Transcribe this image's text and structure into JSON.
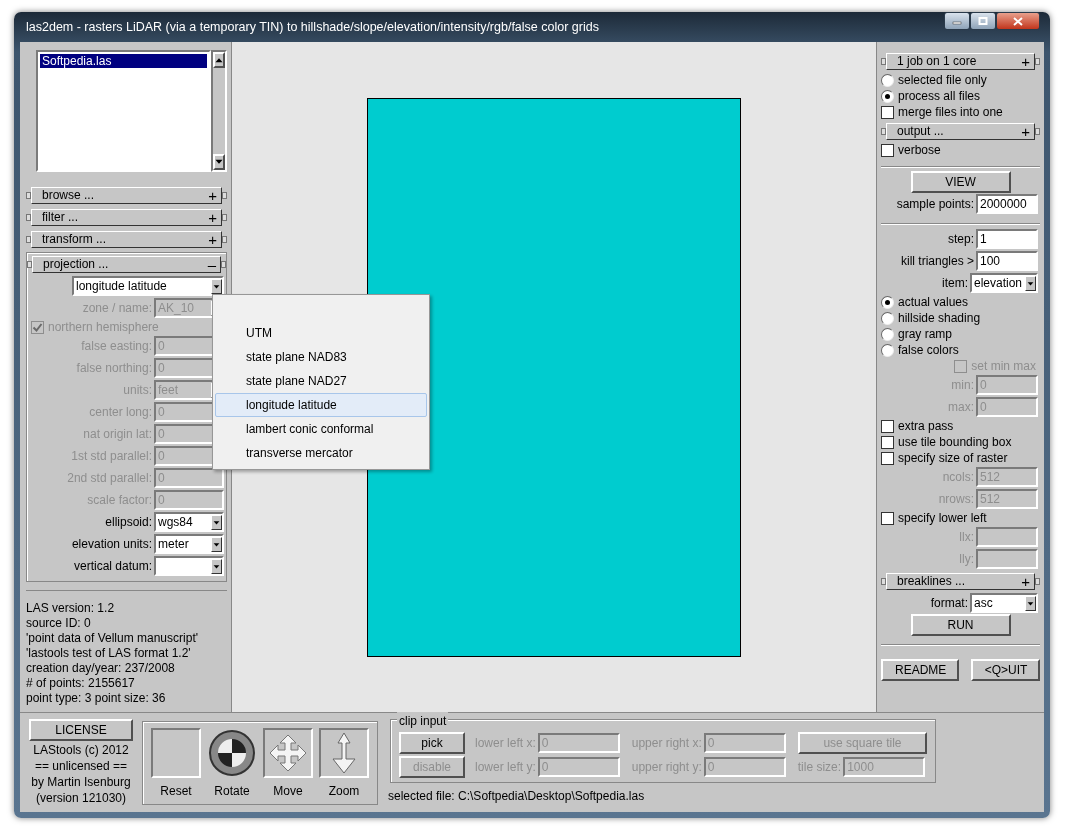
{
  "window": {
    "title": "las2dem - rasters LiDAR (via a temporary TIN) to hillshade/slope/elevation/intensity/rgb/false color grids"
  },
  "file_list": [
    {
      "label": "Softpedia.las",
      "selected": true
    }
  ],
  "sections": [
    {
      "label": "browse ...",
      "sign": "+"
    },
    {
      "label": "filter ...",
      "sign": "+"
    },
    {
      "label": "transform ...",
      "sign": "+"
    }
  ],
  "projection": {
    "label": "projection ...",
    "sign": "–",
    "rows": [
      {
        "kind": "dropdown",
        "value": "longitude latitude",
        "disabled": false
      },
      {
        "kind": "dropdown",
        "label": "zone / name:",
        "value": "AK_10",
        "disabled": true
      },
      {
        "kind": "checkbox",
        "label": "northern hemisphere",
        "checked": true,
        "disabled": true
      },
      {
        "kind": "input",
        "label": "false easting:",
        "value": "0",
        "disabled": true
      },
      {
        "kind": "input",
        "label": "false northing:",
        "value": "0",
        "disabled": true
      },
      {
        "kind": "dropdown",
        "label": "units:",
        "value": "feet",
        "disabled": true
      },
      {
        "kind": "input",
        "label": "center long:",
        "value": "0",
        "disabled": true
      },
      {
        "kind": "input",
        "label": "nat origin lat:",
        "value": "0",
        "disabled": true
      },
      {
        "kind": "input",
        "label": "1st std parallel:",
        "value": "0",
        "disabled": true
      },
      {
        "kind": "input",
        "label": "2nd std parallel:",
        "value": "0",
        "disabled": true
      },
      {
        "kind": "input",
        "label": "scale factor:",
        "value": "0",
        "disabled": true
      },
      {
        "kind": "dropdown",
        "label": "ellipsoid:",
        "value": "wgs84",
        "disabled": false
      },
      {
        "kind": "dropdown",
        "label": "elevation units:",
        "value": "meter",
        "disabled": false
      },
      {
        "kind": "dropdown",
        "label": "vertical datum:",
        "disabled": false
      }
    ]
  },
  "info": [
    "LAS version: 1.2",
    "source ID: 0",
    "'point data of Vellum manuscript'",
    "'lastools test of LAS format 1.2'",
    "creation day/year: 237/2008",
    "# of points: 2155617",
    "point type: 3 point size: 36"
  ],
  "dropdown_menu": [
    {
      "label": "UTM",
      "selected": false
    },
    {
      "label": "state plane NAD83",
      "selected": false
    },
    {
      "label": "state plane NAD27",
      "selected": false
    },
    {
      "label": "longitude latitude",
      "selected": true
    },
    {
      "label": "lambert conic conformal",
      "selected": false
    },
    {
      "label": "transverse mercator",
      "selected": false
    }
  ],
  "right_panel": [
    [
      {
        "kind": "section",
        "label": "1 job on 1 core",
        "sign": "+"
      },
      {
        "kind": "radio",
        "label": "selected file only",
        "selected": false
      },
      {
        "kind": "radio",
        "label": "process all files",
        "selected": true
      },
      {
        "kind": "checkbox",
        "label": "merge files into one",
        "checked": false
      },
      {
        "kind": "section",
        "label": "output ...",
        "sign": "+"
      },
      {
        "kind": "checkbox",
        "label": "verbose",
        "checked": false
      }
    ],
    [
      {
        "kind": "button",
        "label": "VIEW"
      },
      {
        "kind": "input",
        "label": "sample points:",
        "value": "2000000",
        "disabled": false
      }
    ],
    [
      {
        "kind": "input",
        "label": "step:",
        "value": "1",
        "disabled": false
      },
      {
        "kind": "input",
        "label": "kill triangles >",
        "value": "100",
        "disabled": false
      },
      {
        "kind": "dropdown",
        "label": "item:",
        "value": "elevation",
        "disabled": false
      },
      {
        "kind": "radio",
        "label": "actual values",
        "selected": true
      },
      {
        "kind": "radio",
        "label": "hillside shading",
        "selected": false
      },
      {
        "kind": "radio",
        "label": "gray ramp",
        "selected": false
      },
      {
        "kind": "radio",
        "label": "false colors",
        "selected": false
      },
      {
        "kind": "checkbox",
        "label": "set min max",
        "checked": false,
        "disabled": true
      },
      {
        "kind": "input",
        "label": "min:",
        "value": "0",
        "disabled": true
      },
      {
        "kind": "input",
        "label": "max:",
        "value": "0",
        "disabled": true
      },
      {
        "kind": "checkbox",
        "label": "extra pass",
        "checked": false
      },
      {
        "kind": "checkbox",
        "label": "use tile bounding box",
        "checked": false
      },
      {
        "kind": "checkbox",
        "label": "specify size of raster",
        "checked": false
      },
      {
        "kind": "input",
        "label": "ncols:",
        "value": "512",
        "disabled": true
      },
      {
        "kind": "input",
        "label": "nrows:",
        "value": "512",
        "disabled": true
      },
      {
        "kind": "checkbox",
        "label": "specify lower left",
        "checked": false
      },
      {
        "kind": "input",
        "label": "llx:",
        "disabled": true
      },
      {
        "kind": "input",
        "label": "lly:",
        "disabled": true
      },
      {
        "kind": "section",
        "label": "breaklines ...",
        "sign": "+"
      },
      {
        "kind": "dropdown",
        "label": "format:",
        "value": "asc",
        "disabled": false
      },
      {
        "kind": "button",
        "label": "RUN"
      }
    ]
  ],
  "footer_buttons": [
    {
      "label": "README"
    },
    {
      "label": "<Q>UIT"
    }
  ],
  "license": {
    "button": "LICENSE",
    "lines": [
      "LAStools (c) 2012",
      "== unlicensed ==",
      "by Martin Isenburg",
      "(version 121030)"
    ]
  },
  "tools": [
    {
      "kind": "reset",
      "label": "Reset"
    },
    {
      "kind": "rotate",
      "label": "Rotate"
    },
    {
      "kind": "move",
      "label": "Move"
    },
    {
      "kind": "zoom",
      "label": "Zoom"
    }
  ],
  "clip": {
    "title": "clip input",
    "rows": [
      [
        {
          "kind": "button",
          "label": "pick",
          "disabled": false
        },
        {
          "kind": "input",
          "label": "lower left x:",
          "value": "0",
          "disabled": true
        },
        {
          "kind": "input",
          "label": "upper right x:",
          "value": "0",
          "disabled": true
        },
        {
          "kind": "button",
          "label": "use square tile",
          "disabled": true
        }
      ],
      [
        {
          "kind": "button",
          "label": "disable",
          "disabled": true
        },
        {
          "kind": "input",
          "label": "lower left y:",
          "value": "0",
          "disabled": true
        },
        {
          "kind": "input",
          "label": "upper right y:",
          "value": "0",
          "disabled": true
        },
        {
          "kind": "input",
          "label": "tile size:",
          "value": "1000",
          "disabled": true
        }
      ]
    ],
    "selected_file": "selected file: C:\\Softpedia\\Desktop\\Softpedia.las"
  }
}
